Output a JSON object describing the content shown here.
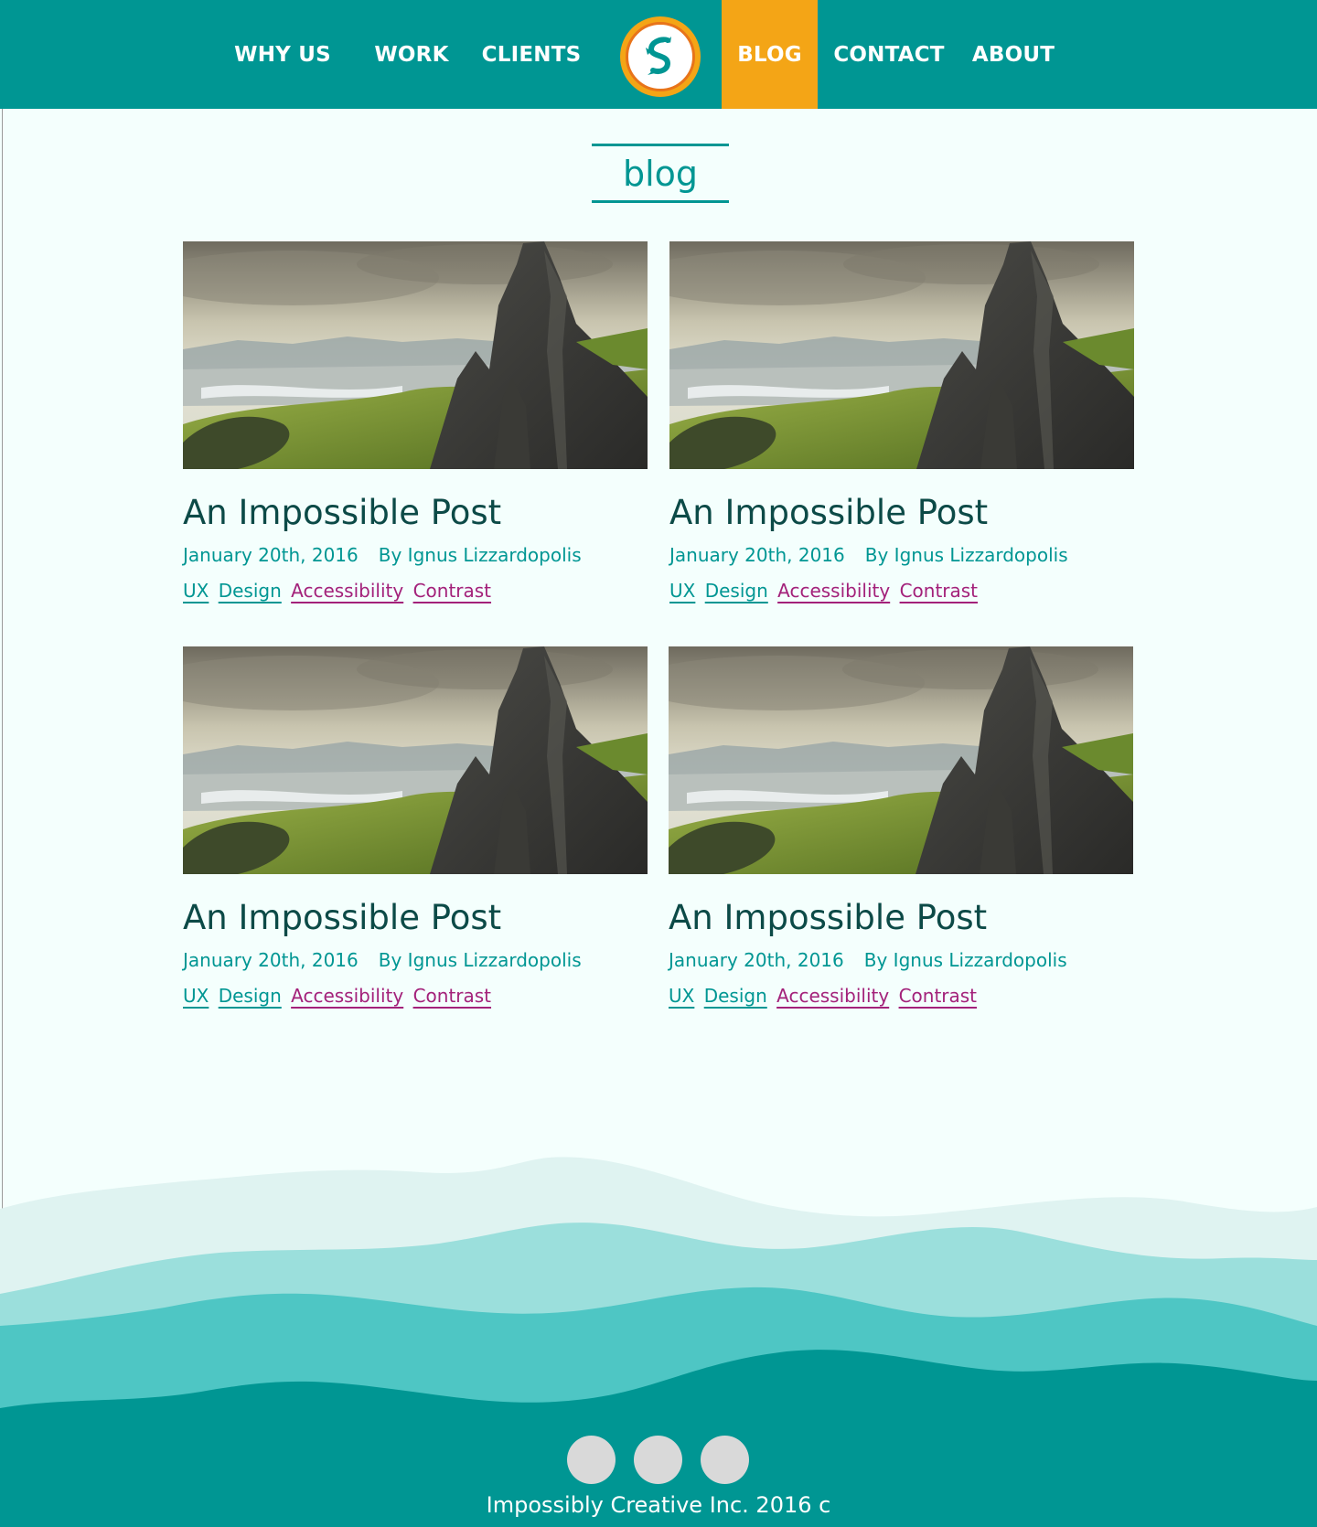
{
  "nav": {
    "items": [
      {
        "label": "WHY US"
      },
      {
        "label": "WORK"
      },
      {
        "label": "CLIENTS"
      },
      {
        "label": "BLOG",
        "active": true
      },
      {
        "label": "CONTACT"
      },
      {
        "label": "ABOUT"
      }
    ],
    "logo_icon": "dragon-s-logo-icon"
  },
  "page": {
    "title": "blog"
  },
  "posts": [
    {
      "title": "An Impossible Post",
      "date": "January 20th, 2016",
      "author": "By Ignus Lizzardopolis",
      "tags": [
        "UX",
        "Design",
        "Accessibility",
        "Contrast"
      ],
      "image": "mountain-landscape-image"
    },
    {
      "title": "An Impossible Post",
      "date": "January 20th, 2016",
      "author": "By Ignus Lizzardopolis",
      "tags": [
        "UX",
        "Design",
        "Accessibility",
        "Contrast"
      ],
      "image": "mountain-landscape-image"
    },
    {
      "title": "An Impossible Post",
      "date": "January 20th, 2016",
      "author": "By Ignus Lizzardopolis",
      "tags": [
        "UX",
        "Design",
        "Accessibility",
        "Contrast"
      ],
      "image": "mountain-landscape-image"
    },
    {
      "title": "An Impossible Post",
      "date": "January 20th, 2016",
      "author": "By Ignus Lizzardopolis",
      "tags": [
        "UX",
        "Design",
        "Accessibility",
        "Contrast"
      ],
      "image": "mountain-landscape-image"
    }
  ],
  "footer": {
    "social_icons": [
      "social-icon",
      "social-icon",
      "social-icon"
    ],
    "copyright": "Impossibly Creative Inc. 2016 c"
  },
  "colors": {
    "brand_teal": "#009693",
    "accent_orange": "#f4a516",
    "tag_magenta": "#a3217a",
    "title_dark": "#0c4a47",
    "background": "#f4fffd"
  }
}
